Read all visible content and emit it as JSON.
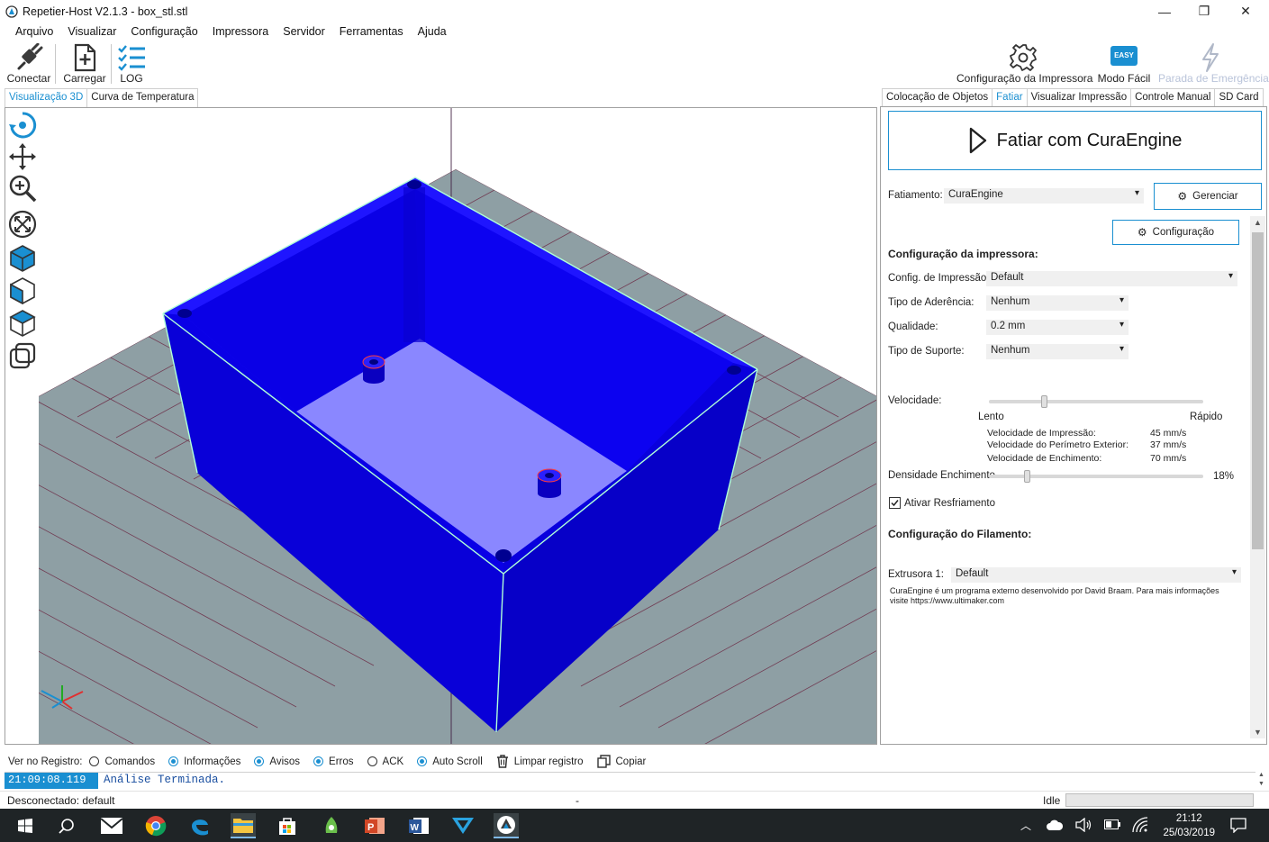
{
  "window": {
    "title": "Repetier-Host V2.1.3 - box_stl.stl",
    "minimize_glyph": "—",
    "restore_glyph": "❐",
    "close_glyph": "✕"
  },
  "menu": [
    "Arquivo",
    "Visualizar",
    "Configuração",
    "Impressora",
    "Servidor",
    "Ferramentas",
    "Ajuda"
  ],
  "toolbar": {
    "connect": "Conectar",
    "load": "Carregar",
    "log": "LOG",
    "printer_config": "Configuração da Impressora",
    "easy_mode": "Modo Fácil",
    "easy_badge": "EASY",
    "emergency": "Parada de Emergência"
  },
  "left_tabs": {
    "view3d": "Visualização 3D",
    "temp_curve": "Curva de Temperatura"
  },
  "right_tabs": {
    "placement": "Colocação de Objetos",
    "slice": "Fatiar",
    "preview": "Visualizar Impressão",
    "manual": "Controle Manual",
    "sdcard": "SD Card"
  },
  "slicer": {
    "slice_button": "Fatiar com CuraEngine",
    "slicer_label": "Fatiamento:",
    "slicer_value": "CuraEngine",
    "manage_button": "Gerenciar",
    "config_button": "Configuração",
    "printer_config_header": "Configuração da impressora:",
    "print_config_label": "Config. de Impressão:",
    "print_config_value": "Default",
    "adhesion_label": "Tipo de Aderência:",
    "adhesion_value": "Nenhum",
    "quality_label": "Qualidade:",
    "quality_value": "0.2 mm",
    "support_label": "Tipo de Suporte:",
    "support_value": "Nenhum",
    "speed_label": "Velocidade:",
    "speed_slow": "Lento",
    "speed_fast": "Rápido",
    "speed_level": 0.26,
    "print_speed_label": "Velocidade de Impressão:",
    "print_speed_value": "45 mm/s",
    "perimeter_speed_label": "Velocidade do Perímetro Exterior:",
    "perimeter_speed_value": "37 mm/s",
    "infill_speed_label": "Velocidade de Enchimento:",
    "infill_speed_value": "70 mm/s",
    "infill_density_label": "Densidade Enchimento",
    "infill_density_value": "18%",
    "infill_density_level": 0.18,
    "cooling_label": "Ativar Resfriamento",
    "cooling_checked": true,
    "filament_header": "Configuração do Filamento:",
    "extruder_label": "Extrusora 1:",
    "extruder_value": "Default",
    "info_line1": "CuraEngine é um programa externo desenvolvido por David Braam. Para mais informações",
    "info_line2": "visite https://www.ultimaker.com"
  },
  "log": {
    "show_label": "Ver no Registro:",
    "commands": "Comandos",
    "info": "Informações",
    "warnings": "Avisos",
    "errors": "Erros",
    "ack": "ACK",
    "autoscroll": "Auto Scroll",
    "clear": "Limpar registro",
    "copy": "Copiar",
    "time": "21:09:08.119",
    "message": "Análise Terminada."
  },
  "status": {
    "connection": "Desconectado: default",
    "middle": "-",
    "state": "Idle"
  },
  "taskbar": {
    "time": "21:12",
    "date": "25/03/2019"
  },
  "colors": {
    "accent": "#1a8fd1",
    "model": "#0a00e6",
    "bed": "#8e9fa4"
  }
}
